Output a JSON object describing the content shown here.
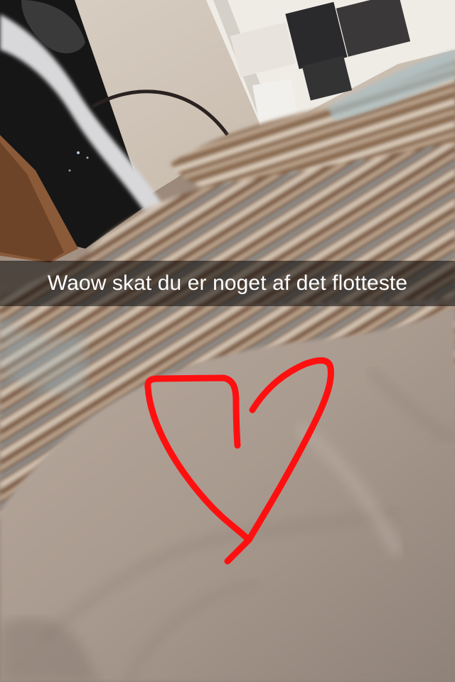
{
  "snap": {
    "caption": "Waow skat du er noget af det flotteste",
    "drawing_icon": "heart-icon",
    "drawing_color": "#ff1010"
  }
}
